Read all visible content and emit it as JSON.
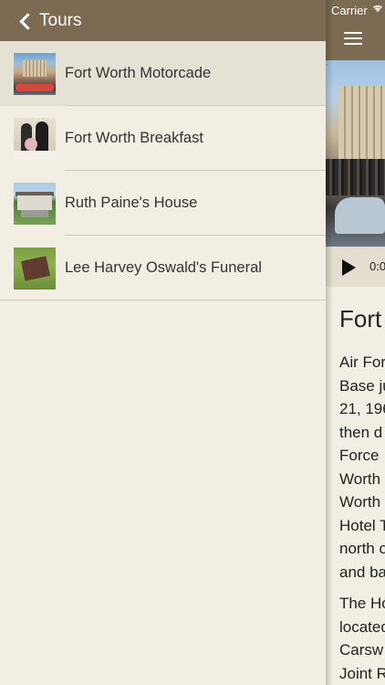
{
  "status_bar": {
    "carrier": "Carrier",
    "wifi_icon": "wifi-icon"
  },
  "sidebar": {
    "back_label": "Tours",
    "back_icon": "chevron-left-icon",
    "items": [
      {
        "label": "Fort Worth Motorcade",
        "thumbnail": "motorcade-photo",
        "selected": true
      },
      {
        "label": "Fort Worth Breakfast",
        "thumbnail": "breakfast-photo",
        "selected": false
      },
      {
        "label": "Ruth Paine's House",
        "thumbnail": "house-photo",
        "selected": false
      },
      {
        "label": "Lee Harvey Oswald's Funeral",
        "thumbnail": "grave-photo",
        "selected": false
      }
    ]
  },
  "detail": {
    "menu_icon": "hamburger-menu-icon",
    "player": {
      "play_icon": "play-icon",
      "time": "0:0"
    },
    "title": "Fort",
    "paragraphs": [
      "Air For\nBase ju\n21, 196\nthen d\nForce \nWorth\nWorth\nHotel T\nnorth o\nand ba",
      "The Ho\nlocated\nCarsw\nJoint R"
    ]
  },
  "colors": {
    "header_brown": "#7c6a52",
    "background": "#f2eee3",
    "selected_row": "#e6e1d5",
    "separator": "#cfc9bb"
  }
}
